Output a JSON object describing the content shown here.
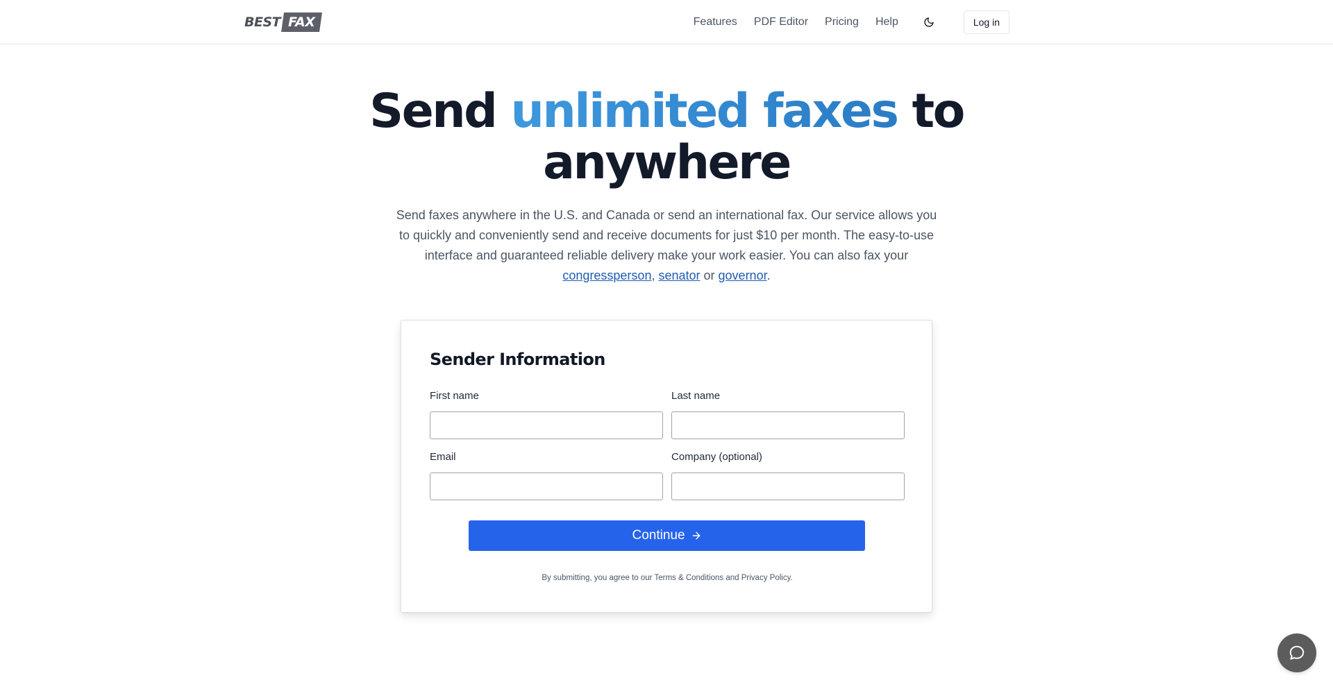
{
  "header": {
    "logo": {
      "part1": "BEST",
      "part2": "FAX"
    },
    "nav": [
      {
        "label": "Features"
      },
      {
        "label": "PDF Editor"
      },
      {
        "label": "Pricing"
      },
      {
        "label": "Help"
      }
    ],
    "theme_toggle_icon": "moon-icon",
    "login_label": "Log in"
  },
  "hero": {
    "title_part1": "Send ",
    "title_accent": "unlimited faxes",
    "title_part2": " to anywhere",
    "accent_colors": [
      "#3f98dd",
      "#2a7cc5"
    ],
    "description": "Send faxes anywhere in the U.S. and Canada or send an international fax. Our service allows you to quickly and conveniently send and receive documents for just $10 per month. The easy-to-use interface and guaranteed reliable delivery make your work easier. You can also fax your ",
    "links": {
      "congressperson": "congressperson",
      "sep1": ", ",
      "senator": "senator",
      "sep2": " or ",
      "governor": "governor",
      "end": "."
    }
  },
  "form": {
    "title": "Sender Information",
    "fields": {
      "first_name": {
        "label": "First name",
        "value": "",
        "placeholder": ""
      },
      "last_name": {
        "label": "Last name",
        "value": "",
        "placeholder": ""
      },
      "email": {
        "label": "Email",
        "value": "",
        "placeholder": ""
      },
      "company": {
        "label": "Company (optional)",
        "value": "",
        "placeholder": ""
      }
    },
    "continue_label": "Continue",
    "continue_icon": "arrow-right-icon",
    "legal": "By submitting, you agree to our Terms & Conditions and Privacy Policy."
  },
  "chat": {
    "icon": "chat-bubble-icon"
  },
  "colors": {
    "primary": "#2563eb",
    "link": "#1e5cb3",
    "heading": "#131a2a",
    "muted": "#4b5563",
    "chat_button": "#5c5c5c"
  }
}
